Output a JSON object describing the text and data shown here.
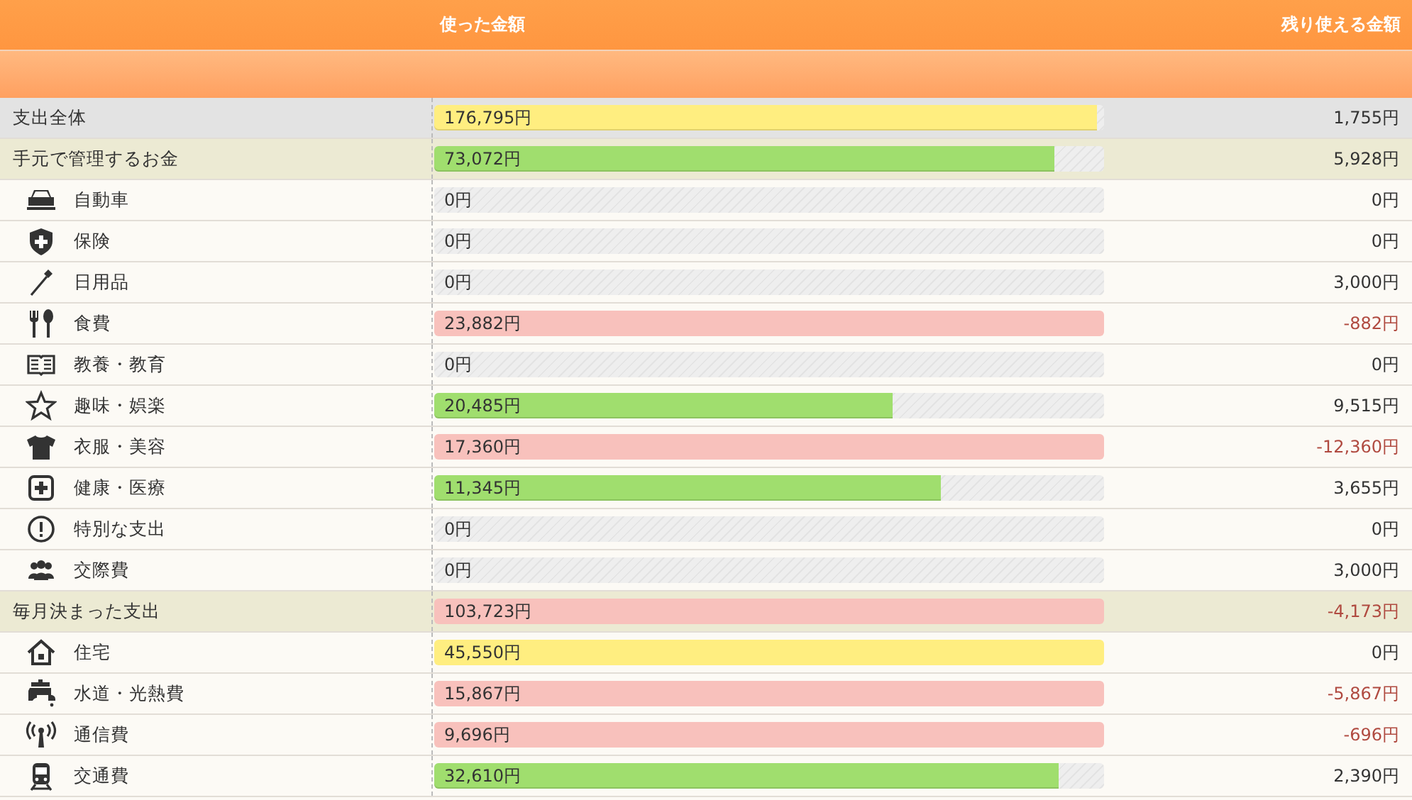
{
  "header": {
    "spent_label": "使った金額",
    "remaining_label": "残り使える金額"
  },
  "rows": [
    {
      "kind": "total",
      "label": "支出全体",
      "spent": "176,795円",
      "level": 0.99,
      "color": "#ffee80",
      "over": false,
      "remaining": "1,755円"
    },
    {
      "kind": "group",
      "label": "手元で管理するお金",
      "spent": "73,072円",
      "level": 0.925,
      "color": "#a0de6e",
      "over": false,
      "remaining": "5,928円"
    },
    {
      "kind": "item",
      "label": "自動車",
      "spent": "0円",
      "over": false,
      "remaining": "0円"
    },
    {
      "kind": "item",
      "label": "保険",
      "spent": "0円",
      "over": false,
      "remaining": "0円"
    },
    {
      "kind": "item",
      "label": "日用品",
      "spent": "0円",
      "over": false,
      "remaining": "3,000円"
    },
    {
      "kind": "item",
      "label": "食費",
      "spent": "23,882円",
      "level": 1,
      "color": "#f8c1bc",
      "over": true,
      "remaining": "-882円"
    },
    {
      "kind": "item",
      "label": "教養・教育",
      "spent": "0円",
      "over": false,
      "remaining": "0円"
    },
    {
      "kind": "item",
      "label": "趣味・娯楽",
      "spent": "20,485円",
      "level": 0.684,
      "color": "#a0de6e",
      "over": false,
      "remaining": "9,515円"
    },
    {
      "kind": "item",
      "label": "衣服・美容",
      "spent": "17,360円",
      "level": 1,
      "color": "#f8c1bc",
      "over": true,
      "remaining": "-12,360円"
    },
    {
      "kind": "item",
      "label": "健康・医療",
      "spent": "11,345円",
      "level": 0.756,
      "color": "#a0de6e",
      "over": false,
      "remaining": "3,655円"
    },
    {
      "kind": "item",
      "label": "特別な支出",
      "spent": "0円",
      "over": false,
      "remaining": "0円"
    },
    {
      "kind": "item",
      "label": "交際費",
      "spent": "0円",
      "over": false,
      "remaining": "3,000円"
    },
    {
      "kind": "group",
      "label": "毎月決まった支出",
      "spent": "103,723円",
      "level": 1,
      "color": "#f8c1bc",
      "over": true,
      "remaining": "-4,173円"
    },
    {
      "kind": "item",
      "label": "住宅",
      "spent": "45,550円",
      "level": 1,
      "color": "#ffee80",
      "over": false,
      "remaining": "0円"
    },
    {
      "kind": "item",
      "label": "水道・光熱費",
      "spent": "15,867円",
      "level": 1,
      "color": "#f8c1bc",
      "over": true,
      "remaining": "-5,867円"
    },
    {
      "kind": "item",
      "label": "通信費",
      "spent": "9,696円",
      "level": 1,
      "color": "#f8c1bc",
      "over": true,
      "remaining": "-696円"
    },
    {
      "kind": "item",
      "label": "交通費",
      "spent": "32,610円",
      "level": 0.932,
      "color": "#a0de6e",
      "over": false,
      "remaining": "2,390円"
    }
  ]
}
